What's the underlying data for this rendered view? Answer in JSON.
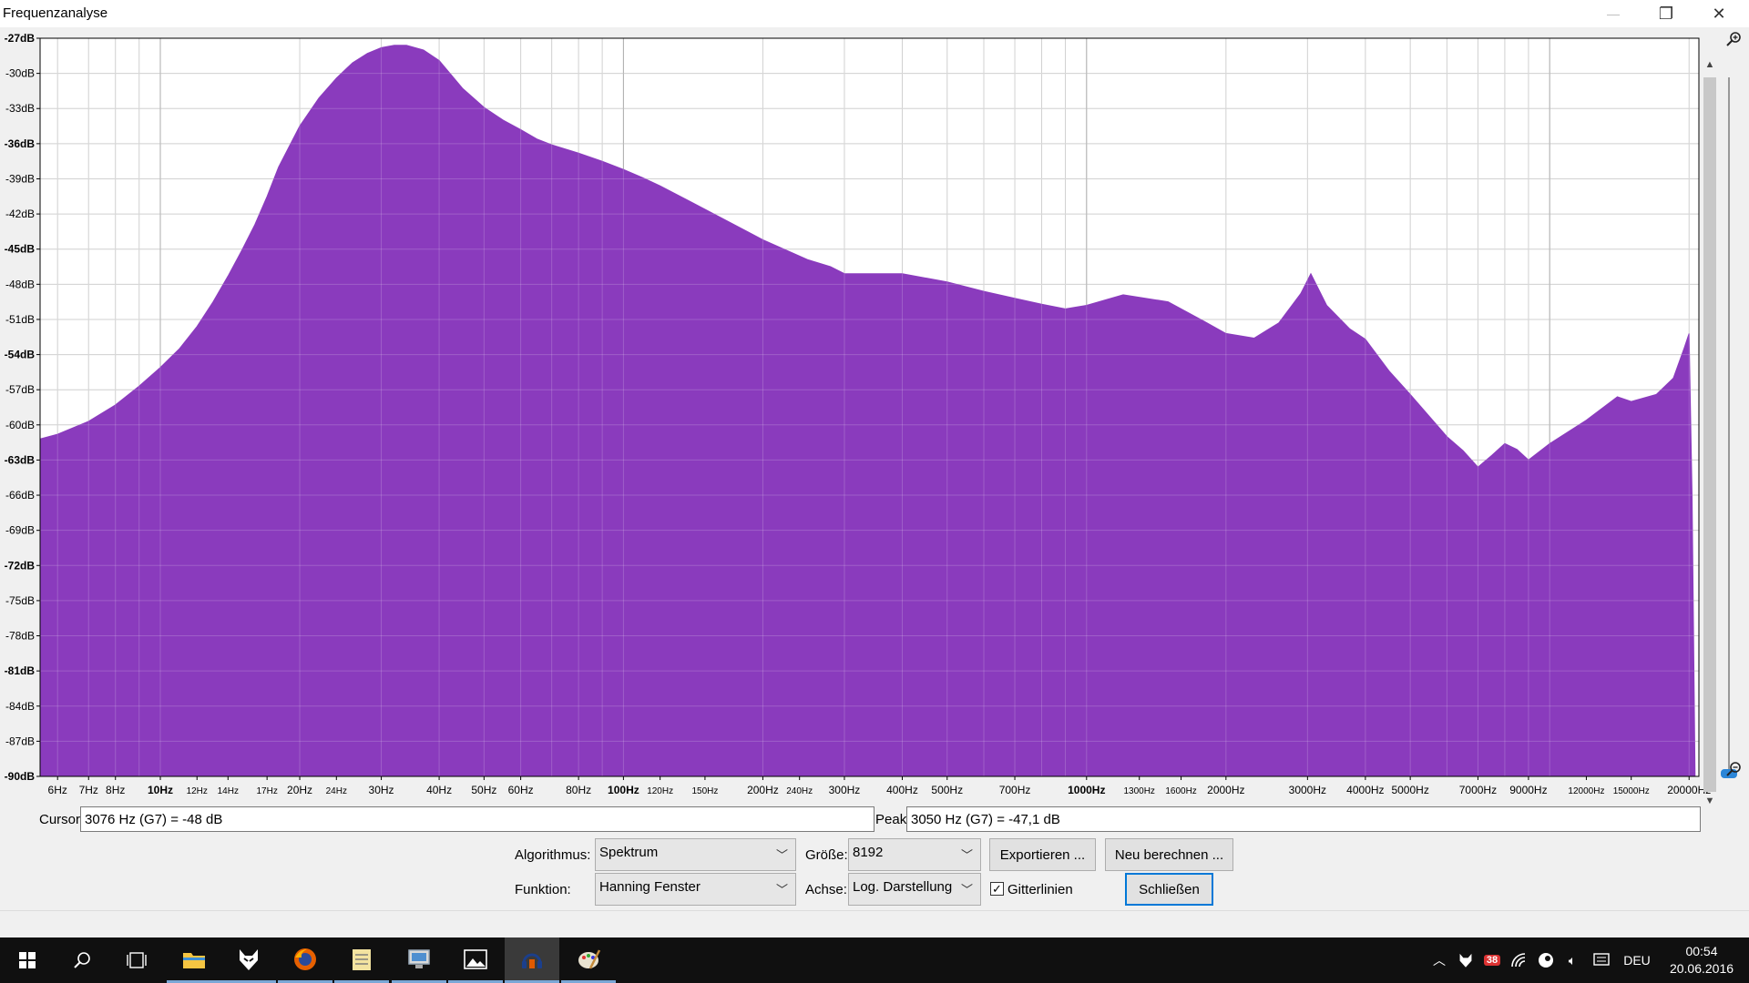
{
  "window": {
    "title": "Frequenzanalyse",
    "minimize_glyph": "—",
    "restore_glyph": "❐",
    "close_glyph": "✕"
  },
  "chart_data": {
    "type": "area",
    "title": "",
    "xlabel": "",
    "ylabel": "",
    "x_scale": "log",
    "xlim": [
      5.5,
      21000
    ],
    "ylim": [
      -90,
      -27
    ],
    "grid": true,
    "fill_color": "#8a3bbd",
    "y_ticks": [
      "-27dB",
      "-30dB",
      "-33dB",
      "-36dB",
      "-39dB",
      "-42dB",
      "-45dB",
      "-48dB",
      "-51dB",
      "-54dB",
      "-57dB",
      "-60dB",
      "-63dB",
      "-66dB",
      "-69dB",
      "-72dB",
      "-75dB",
      "-78dB",
      "-81dB",
      "-84dB",
      "-87dB",
      "-90dB"
    ],
    "y_tick_values": [
      -27,
      -30,
      -33,
      -36,
      -39,
      -42,
      -45,
      -48,
      -51,
      -54,
      -57,
      -60,
      -63,
      -66,
      -69,
      -72,
      -75,
      -78,
      -81,
      -84,
      -87,
      -90
    ],
    "x_ticks": [
      {
        "hz": 6,
        "label": "6Hz",
        "bold": false
      },
      {
        "hz": 7,
        "label": "7Hz",
        "bold": false
      },
      {
        "hz": 8,
        "label": "8Hz",
        "bold": false
      },
      {
        "hz": 10,
        "label": "10Hz",
        "bold": true
      },
      {
        "hz": 12,
        "label": "12Hz",
        "bold": false,
        "small": true
      },
      {
        "hz": 14,
        "label": "14Hz",
        "bold": false,
        "small": true
      },
      {
        "hz": 17,
        "label": "17Hz",
        "bold": false,
        "small": true
      },
      {
        "hz": 20,
        "label": "20Hz",
        "bold": false
      },
      {
        "hz": 24,
        "label": "24Hz",
        "bold": false,
        "small": true
      },
      {
        "hz": 30,
        "label": "30Hz",
        "bold": false
      },
      {
        "hz": 40,
        "label": "40Hz",
        "bold": false
      },
      {
        "hz": 50,
        "label": "50Hz",
        "bold": false
      },
      {
        "hz": 60,
        "label": "60Hz",
        "bold": false
      },
      {
        "hz": 80,
        "label": "80Hz",
        "bold": false
      },
      {
        "hz": 100,
        "label": "100Hz",
        "bold": true
      },
      {
        "hz": 120,
        "label": "120Hz",
        "bold": false,
        "small": true
      },
      {
        "hz": 150,
        "label": "150Hz",
        "bold": false,
        "small": true
      },
      {
        "hz": 200,
        "label": "200Hz",
        "bold": false
      },
      {
        "hz": 240,
        "label": "240Hz",
        "bold": false,
        "small": true
      },
      {
        "hz": 300,
        "label": "300Hz",
        "bold": false
      },
      {
        "hz": 400,
        "label": "400Hz",
        "bold": false
      },
      {
        "hz": 500,
        "label": "500Hz",
        "bold": false
      },
      {
        "hz": 700,
        "label": "700Hz",
        "bold": false
      },
      {
        "hz": 1000,
        "label": "1000Hz",
        "bold": true
      },
      {
        "hz": 1300,
        "label": "1300Hz",
        "bold": false,
        "small": true
      },
      {
        "hz": 1600,
        "label": "1600Hz",
        "bold": false,
        "small": true
      },
      {
        "hz": 2000,
        "label": "2000Hz",
        "bold": false
      },
      {
        "hz": 3000,
        "label": "3000Hz",
        "bold": false
      },
      {
        "hz": 4000,
        "label": "4000Hz",
        "bold": false
      },
      {
        "hz": 5000,
        "label": "5000Hz",
        "bold": false
      },
      {
        "hz": 7000,
        "label": "7000Hz",
        "bold": false
      },
      {
        "hz": 9000,
        "label": "9000Hz",
        "bold": false
      },
      {
        "hz": 12000,
        "label": "12000Hz",
        "bold": false,
        "small": true
      },
      {
        "hz": 15000,
        "label": "15000Hz",
        "bold": false,
        "small": true
      },
      {
        "hz": 20000,
        "label": "20000Hz",
        "bold": false
      }
    ],
    "series": [
      {
        "x": [
          5.5,
          6,
          7,
          8,
          9,
          10,
          11,
          12,
          13,
          14,
          15,
          16,
          17,
          18,
          20,
          22,
          24,
          26,
          28,
          30,
          32,
          34,
          37,
          40,
          45,
          50,
          55,
          60,
          65,
          70,
          80,
          90,
          100,
          110,
          120,
          150,
          200,
          250,
          280,
          300,
          400,
          500,
          600,
          700,
          800,
          900,
          1000,
          1200,
          1500,
          1800,
          2000,
          2300,
          2600,
          2900,
          3050,
          3300,
          3700,
          4000,
          4500,
          5000,
          6000,
          6500,
          7000,
          7500,
          8000,
          8500,
          9000,
          10000,
          12000,
          14000,
          15000,
          17000,
          18500,
          19500,
          20000,
          20300,
          20600
        ],
        "y": [
          -61.2,
          -60.8,
          -59.7,
          -58.3,
          -56.7,
          -55.1,
          -53.5,
          -51.6,
          -49.5,
          -47.3,
          -45.1,
          -42.9,
          -40.5,
          -38.0,
          -34.5,
          -32.1,
          -30.4,
          -29.1,
          -28.3,
          -27.8,
          -27.6,
          -27.6,
          -28.0,
          -28.9,
          -31.3,
          -32.9,
          -34.0,
          -34.8,
          -35.6,
          -36.1,
          -36.8,
          -37.5,
          -38.2,
          -38.9,
          -39.6,
          -41.6,
          -44.2,
          -45.9,
          -46.5,
          -47.1,
          -47.1,
          -47.8,
          -48.6,
          -49.2,
          -49.7,
          -50.1,
          -49.8,
          -48.9,
          -49.5,
          -51.2,
          -52.2,
          -52.6,
          -51.3,
          -48.8,
          -47.1,
          -49.8,
          -51.8,
          -52.7,
          -55.4,
          -57.4,
          -61.0,
          -62.2,
          -63.6,
          -62.6,
          -61.6,
          -62.1,
          -63.0,
          -61.6,
          -59.6,
          -57.6,
          -58.0,
          -57.4,
          -56.0,
          -53.5,
          -52.2,
          -66.0,
          -90.0
        ]
      }
    ]
  },
  "readouts": {
    "cursor_label": "Cursor:",
    "cursor_value": "3076 Hz (G7) = -48 dB",
    "peak_label": "Peak:",
    "peak_value": "3050 Hz (G7) = -47,1 dB"
  },
  "controls": {
    "algorithmus_label": "Algorithmus:",
    "algorithmus_value": "Spektrum",
    "groesse_label": "Größe:",
    "groesse_value": "8192",
    "export_button": "Exportieren ...",
    "recalc_button": "Neu berechnen ...",
    "funktion_label": "Funktion:",
    "funktion_value": "Hanning Fenster",
    "achse_label": "Achse:",
    "achse_value": "Log. Darstellung",
    "gitterlinien_label": "Gitterlinien",
    "gitterlinien_checked": true,
    "close_button": "Schließen"
  },
  "taskbar": {
    "apps": [
      "start-icon",
      "search-icon",
      "task-view-icon",
      "file-explorer-icon",
      "foobar-icon",
      "firefox-icon",
      "notepad-icon",
      "remote-desktop-icon",
      "photos-icon",
      "audacity-icon",
      "paint-icon"
    ],
    "tray": {
      "language": "DEU",
      "time": "00:54",
      "date": "20.06.2016",
      "badge": "38"
    }
  }
}
